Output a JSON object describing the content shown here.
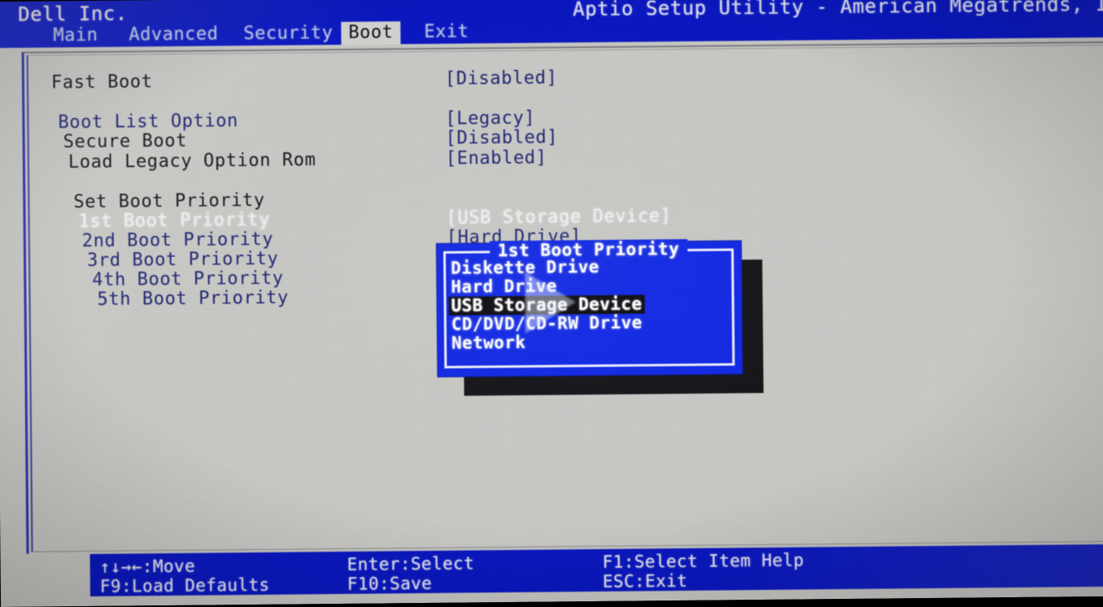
{
  "header": {
    "oem": "Dell Inc.",
    "utility_title": "Aptio Setup Utility - American Megatrends, Inc",
    "tabs": [
      {
        "label": "Main",
        "active": false
      },
      {
        "label": "Advanced",
        "active": false
      },
      {
        "label": "Security",
        "active": false
      },
      {
        "label": "Boot",
        "active": true
      },
      {
        "label": "Exit",
        "active": false
      }
    ]
  },
  "settings": [
    {
      "label": "Fast Boot",
      "value": "[Disabled]",
      "selected": false,
      "group_header": false
    },
    {
      "label": "Boot List Option",
      "value": "[Legacy]",
      "selected": false,
      "group_header": false
    },
    {
      "label": "Secure Boot",
      "value": "[Disabled]",
      "selected": false,
      "group_header": false
    },
    {
      "label": "Load Legacy Option Rom",
      "value": "[Enabled]",
      "selected": false,
      "group_header": false
    },
    {
      "label": "Set Boot Priority",
      "value": "",
      "selected": false,
      "group_header": true
    },
    {
      "label": "1st Boot Priority",
      "value": "[USB Storage Device]",
      "selected": true,
      "group_header": false
    },
    {
      "label": "2nd Boot Priority",
      "value": "[Hard Drive]",
      "selected": false,
      "group_header": false
    },
    {
      "label": "3rd Boot Priority",
      "value": "",
      "selected": false,
      "group_header": false
    },
    {
      "label": "4th Boot Priority",
      "value": "",
      "selected": false,
      "group_header": false
    },
    {
      "label": "5th Boot Priority",
      "value": "",
      "selected": false,
      "group_header": false
    }
  ],
  "dialog": {
    "title": "1st Boot Priority",
    "options": [
      {
        "label": "Diskette Drive",
        "selected": false
      },
      {
        "label": "Hard Drive",
        "selected": false
      },
      {
        "label": "USB Storage Device",
        "selected": true
      },
      {
        "label": "CD/DVD/CD-RW Drive",
        "selected": false
      },
      {
        "label": "Network",
        "selected": false
      }
    ]
  },
  "footer": {
    "move": "↑↓→←:Move",
    "enter_select": "Enter:Select",
    "item_help": "F1:Select Item Help",
    "load_defaults": "F9:Load Defaults",
    "save": "F10:Save",
    "exit": "ESC:Exit"
  },
  "colors": {
    "bios_blue": "#0b18c2",
    "dialog_blue": "#0f27e6",
    "panel_grey": "#c9c9c6",
    "text_navy": "#1d2472",
    "text_white": "#f2f2f4",
    "selection_black": "#0a0a0f"
  }
}
